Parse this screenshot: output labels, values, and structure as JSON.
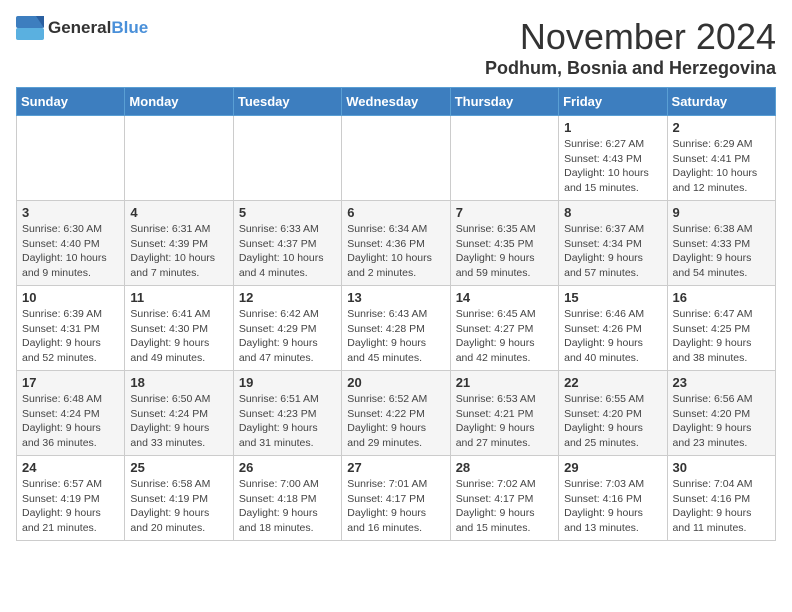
{
  "logo": {
    "general": "General",
    "blue": "Blue"
  },
  "header": {
    "month": "November 2024",
    "location": "Podhum, Bosnia and Herzegovina"
  },
  "weekdays": [
    "Sunday",
    "Monday",
    "Tuesday",
    "Wednesday",
    "Thursday",
    "Friday",
    "Saturday"
  ],
  "weeks": [
    [
      {
        "day": "",
        "info": ""
      },
      {
        "day": "",
        "info": ""
      },
      {
        "day": "",
        "info": ""
      },
      {
        "day": "",
        "info": ""
      },
      {
        "day": "",
        "info": ""
      },
      {
        "day": "1",
        "info": "Sunrise: 6:27 AM\nSunset: 4:43 PM\nDaylight: 10 hours and 15 minutes."
      },
      {
        "day": "2",
        "info": "Sunrise: 6:29 AM\nSunset: 4:41 PM\nDaylight: 10 hours and 12 minutes."
      }
    ],
    [
      {
        "day": "3",
        "info": "Sunrise: 6:30 AM\nSunset: 4:40 PM\nDaylight: 10 hours and 9 minutes."
      },
      {
        "day": "4",
        "info": "Sunrise: 6:31 AM\nSunset: 4:39 PM\nDaylight: 10 hours and 7 minutes."
      },
      {
        "day": "5",
        "info": "Sunrise: 6:33 AM\nSunset: 4:37 PM\nDaylight: 10 hours and 4 minutes."
      },
      {
        "day": "6",
        "info": "Sunrise: 6:34 AM\nSunset: 4:36 PM\nDaylight: 10 hours and 2 minutes."
      },
      {
        "day": "7",
        "info": "Sunrise: 6:35 AM\nSunset: 4:35 PM\nDaylight: 9 hours and 59 minutes."
      },
      {
        "day": "8",
        "info": "Sunrise: 6:37 AM\nSunset: 4:34 PM\nDaylight: 9 hours and 57 minutes."
      },
      {
        "day": "9",
        "info": "Sunrise: 6:38 AM\nSunset: 4:33 PM\nDaylight: 9 hours and 54 minutes."
      }
    ],
    [
      {
        "day": "10",
        "info": "Sunrise: 6:39 AM\nSunset: 4:31 PM\nDaylight: 9 hours and 52 minutes."
      },
      {
        "day": "11",
        "info": "Sunrise: 6:41 AM\nSunset: 4:30 PM\nDaylight: 9 hours and 49 minutes."
      },
      {
        "day": "12",
        "info": "Sunrise: 6:42 AM\nSunset: 4:29 PM\nDaylight: 9 hours and 47 minutes."
      },
      {
        "day": "13",
        "info": "Sunrise: 6:43 AM\nSunset: 4:28 PM\nDaylight: 9 hours and 45 minutes."
      },
      {
        "day": "14",
        "info": "Sunrise: 6:45 AM\nSunset: 4:27 PM\nDaylight: 9 hours and 42 minutes."
      },
      {
        "day": "15",
        "info": "Sunrise: 6:46 AM\nSunset: 4:26 PM\nDaylight: 9 hours and 40 minutes."
      },
      {
        "day": "16",
        "info": "Sunrise: 6:47 AM\nSunset: 4:25 PM\nDaylight: 9 hours and 38 minutes."
      }
    ],
    [
      {
        "day": "17",
        "info": "Sunrise: 6:48 AM\nSunset: 4:24 PM\nDaylight: 9 hours and 36 minutes."
      },
      {
        "day": "18",
        "info": "Sunrise: 6:50 AM\nSunset: 4:24 PM\nDaylight: 9 hours and 33 minutes."
      },
      {
        "day": "19",
        "info": "Sunrise: 6:51 AM\nSunset: 4:23 PM\nDaylight: 9 hours and 31 minutes."
      },
      {
        "day": "20",
        "info": "Sunrise: 6:52 AM\nSunset: 4:22 PM\nDaylight: 9 hours and 29 minutes."
      },
      {
        "day": "21",
        "info": "Sunrise: 6:53 AM\nSunset: 4:21 PM\nDaylight: 9 hours and 27 minutes."
      },
      {
        "day": "22",
        "info": "Sunrise: 6:55 AM\nSunset: 4:20 PM\nDaylight: 9 hours and 25 minutes."
      },
      {
        "day": "23",
        "info": "Sunrise: 6:56 AM\nSunset: 4:20 PM\nDaylight: 9 hours and 23 minutes."
      }
    ],
    [
      {
        "day": "24",
        "info": "Sunrise: 6:57 AM\nSunset: 4:19 PM\nDaylight: 9 hours and 21 minutes."
      },
      {
        "day": "25",
        "info": "Sunrise: 6:58 AM\nSunset: 4:19 PM\nDaylight: 9 hours and 20 minutes."
      },
      {
        "day": "26",
        "info": "Sunrise: 7:00 AM\nSunset: 4:18 PM\nDaylight: 9 hours and 18 minutes."
      },
      {
        "day": "27",
        "info": "Sunrise: 7:01 AM\nSunset: 4:17 PM\nDaylight: 9 hours and 16 minutes."
      },
      {
        "day": "28",
        "info": "Sunrise: 7:02 AM\nSunset: 4:17 PM\nDaylight: 9 hours and 15 minutes."
      },
      {
        "day": "29",
        "info": "Sunrise: 7:03 AM\nSunset: 4:16 PM\nDaylight: 9 hours and 13 minutes."
      },
      {
        "day": "30",
        "info": "Sunrise: 7:04 AM\nSunset: 4:16 PM\nDaylight: 9 hours and 11 minutes."
      }
    ]
  ]
}
